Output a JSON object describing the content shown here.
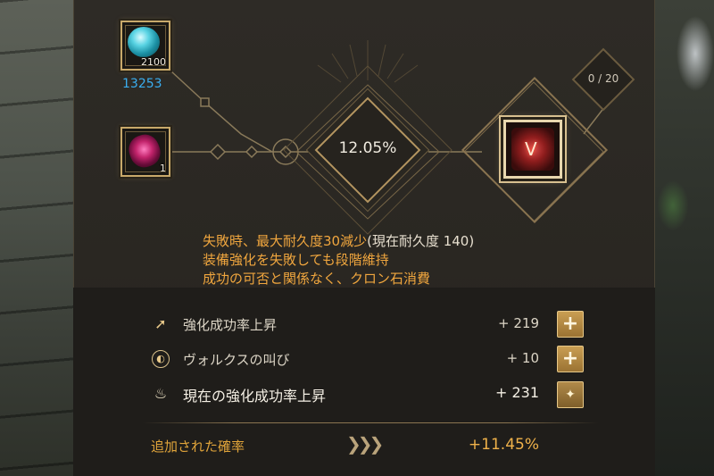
{
  "materials": {
    "crystal_count": "2100",
    "crystal_total": "13253",
    "stone_count": "1"
  },
  "enhance": {
    "rate": "12.05%",
    "attempt_counter": "0 / 20"
  },
  "warnings": {
    "line1_main": "失敗時、最大耐久度30減少",
    "line1_sub": "(現在耐久度 140)",
    "line2": "装備強化を失敗しても段階維持",
    "line3": "成功の可否と関係なく、クロン石消費"
  },
  "bonuses": [
    {
      "label": "強化成功率上昇",
      "value": "+ 219"
    },
    {
      "label": "ヴォルクスの叫び",
      "value": "+ 10"
    },
    {
      "label": "現在の強化成功率上昇",
      "value": "+ 231"
    }
  ],
  "added": {
    "label": "追加された確率",
    "value": "+11.45%"
  },
  "icons": {
    "row1": "arrow-up-icon",
    "row2": "vorx-cry-icon",
    "row3": "flame-icon",
    "button_add": "plus-icon",
    "button_support": "support-icon"
  },
  "colors": {
    "accent_gold": "#c8a96a",
    "warning_orange": "#f0a63e",
    "total_blue": "#3aaef0"
  }
}
